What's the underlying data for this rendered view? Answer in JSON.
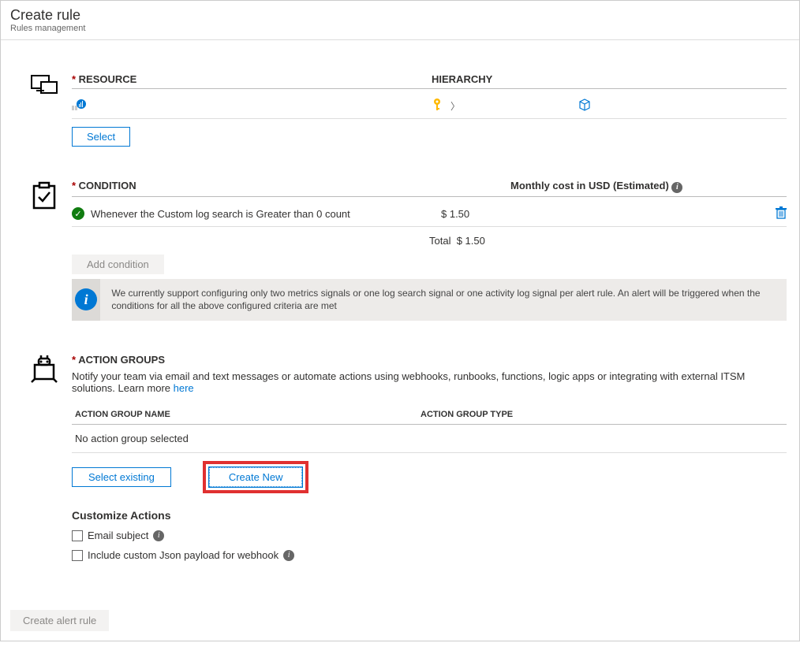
{
  "header": {
    "title": "Create rule",
    "subtitle": "Rules management"
  },
  "resource": {
    "label": "RESOURCE",
    "hierarchy_label": "HIERARCHY",
    "select_btn": "Select"
  },
  "condition": {
    "label": "CONDITION",
    "cost_label": "Monthly cost in USD (Estimated)",
    "item_text": "Whenever the Custom log search is Greater than 0 count",
    "item_cost": "$ 1.50",
    "total_label": "Total",
    "total_value": "$ 1.50",
    "add_btn": "Add condition",
    "info": "We currently support configuring only two metrics signals or one log search signal or one activity log signal per alert rule. An alert will be triggered when the conditions for all the above configured criteria are met"
  },
  "action_groups": {
    "label": "ACTION GROUPS",
    "desc": "Notify your team via email and text messages or automate actions using webhooks, runbooks, functions, logic apps or integrating with external ITSM solutions. Learn more ",
    "learn_more": "here",
    "col_name": "ACTION GROUP NAME",
    "col_type": "ACTION GROUP TYPE",
    "empty": "No action group selected",
    "select_existing": "Select existing",
    "create_new": "Create New",
    "customize_title": "Customize Actions",
    "email_subject": "Email subject",
    "json_payload": "Include custom Json payload for webhook"
  },
  "footer": {
    "create": "Create alert rule"
  }
}
